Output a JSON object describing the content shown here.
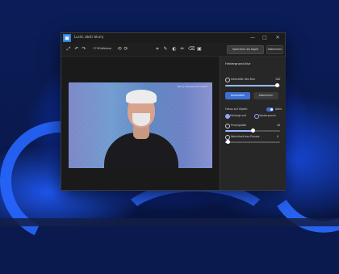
{
  "window": {
    "title": "Lucid, abstr blurry",
    "app_icon": "photos-app-icon"
  },
  "window_controls": {
    "minimize": "—",
    "maximize": "□",
    "close": "✕"
  },
  "toolbar": {
    "zoom": "37%",
    "filename": "FileName",
    "save_copy_label": "Speichern als Kopie",
    "cancel_label": "Abbrechen",
    "icons": {
      "zoom": "⤢",
      "undo": "↶",
      "redo": "↷",
      "crop": "⌗",
      "adjust": "✎",
      "filter": "◐",
      "markup": "✏",
      "erase": "⌫",
      "background": "▣",
      "rotate_left": "⟲",
      "rotate_right": "⟳"
    }
  },
  "photo": {
    "watermark": "Blurry background effect"
  },
  "panel": {
    "title": "Hintergrund blur",
    "intensity_label": "Intensität des Blur",
    "intensity_value": "100",
    "intensity_level": 0.95,
    "apply_label": "Anwenden",
    "cancel_label": "Abbrechen",
    "focus_label": "Fokus auf Objekt",
    "focus_state": "Aktiv",
    "option_a": "Hintergrund",
    "option_b": "Vordergrund",
    "brush_size_label": "Pinselgröße",
    "brush_size_value": "40",
    "brush_size_level": 0.5,
    "softness_label": "Weichheit des Pinsels",
    "softness_value": "0",
    "softness_level": 0.05
  }
}
